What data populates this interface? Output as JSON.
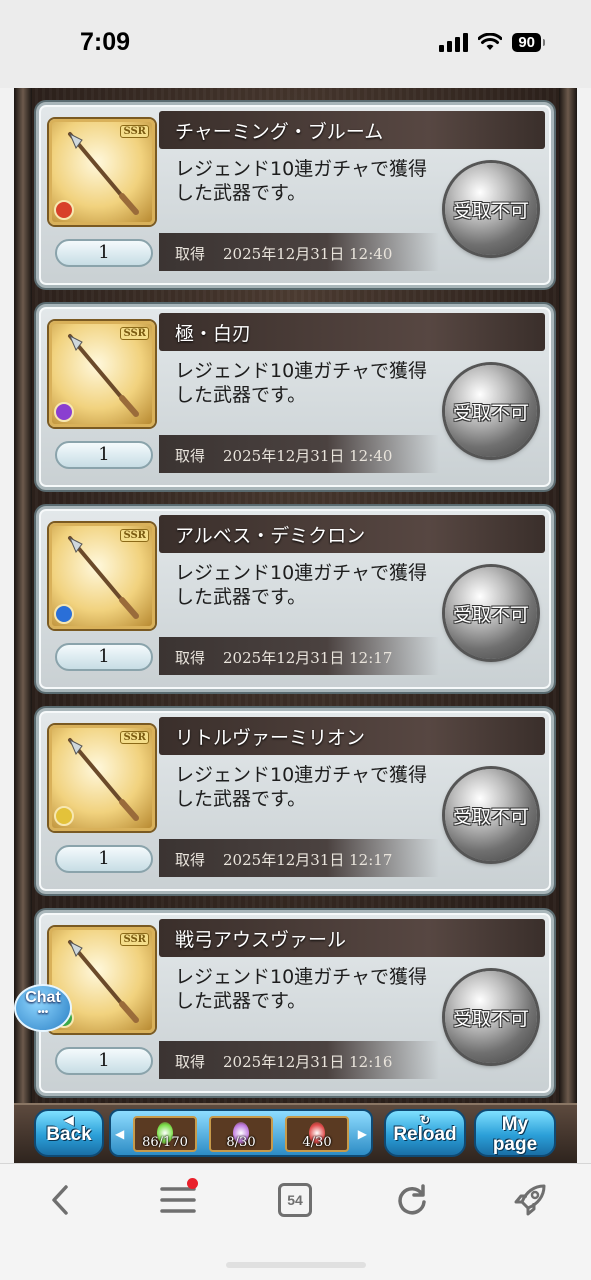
{
  "status_bar": {
    "time": "7:09",
    "battery": "90"
  },
  "items": [
    {
      "name": "チャーミング・ブルーム",
      "rarity": "SSR",
      "description": "レジェンド10連ガチャで獲得した武器です。",
      "quantity": "1",
      "obtained_label": "取得",
      "obtained_at": "2025年12月31日 12:40",
      "button_label": "受取不可",
      "element_color": "#d8402a"
    },
    {
      "name": "極・白刃",
      "rarity": "SSR",
      "description": "レジェンド10連ガチャで獲得した武器です。",
      "quantity": "1",
      "obtained_label": "取得",
      "obtained_at": "2025年12月31日 12:40",
      "button_label": "受取不可",
      "element_color": "#8a3fd0"
    },
    {
      "name": "アルベス・デミクロン",
      "rarity": "SSR",
      "description": "レジェンド10連ガチャで獲得した武器です。",
      "quantity": "1",
      "obtained_label": "取得",
      "obtained_at": "2025年12月31日 12:17",
      "button_label": "受取不可",
      "element_color": "#2a6fd8"
    },
    {
      "name": "リトルヴァーミリオン",
      "rarity": "SSR",
      "description": "レジェンド10連ガチャで獲得した武器です。",
      "quantity": "1",
      "obtained_label": "取得",
      "obtained_at": "2025年12月31日 12:17",
      "button_label": "受取不可",
      "element_color": "#e3c23a"
    },
    {
      "name": "戦弓アウスヴァール",
      "rarity": "SSR",
      "description": "レジェンド10連ガチャで獲得した武器です。",
      "quantity": "1",
      "obtained_label": "取得",
      "obtained_at": "2025年12月31日 12:16",
      "button_label": "受取不可",
      "element_color": "#3aa84a"
    }
  ],
  "chat_button": {
    "label": "Chat",
    "dots": "•••"
  },
  "game_bar": {
    "back_label": "Back",
    "reload_label": "Reload",
    "mypage_label_line1": "My",
    "mypage_label_line2": "page",
    "resources": [
      {
        "count": "86/170",
        "color": "#7be04a"
      },
      {
        "count": "8/30",
        "color": "#c07be0"
      },
      {
        "count": "4/30",
        "color": "#e04a4a"
      }
    ]
  },
  "browser_toolbar": {
    "tab_count": "54",
    "icons": [
      "back-arrow-icon",
      "menu-icon",
      "tabs-icon",
      "refresh-icon",
      "rocket-icon"
    ]
  }
}
